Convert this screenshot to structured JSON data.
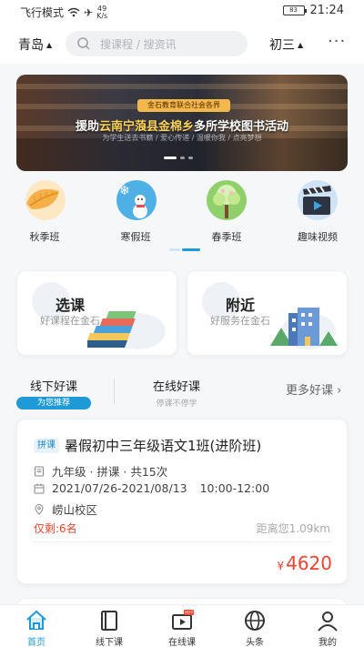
{
  "status_bar": {
    "left_text": "飞行模式",
    "speed": "49",
    "speed_unit": "K/s",
    "battery": "83",
    "time": "21:24"
  },
  "header": {
    "city": "青岛",
    "search_placeholder": "搜课程 / 搜资讯",
    "grade": "初三",
    "more_glyph": "···"
  },
  "banner": {
    "org_label": "金石教育联合社会各界",
    "headline_prefix": "援助",
    "headline_highlight": "云南宁蒗县金棉乡",
    "headline_suffix": "多所学校图书活动",
    "subline": "为学生送去书籍 / 爱心传递 / 温暖你我 / 点亮梦想",
    "page_count": 3,
    "active_page": 1
  },
  "categories": [
    {
      "label": "秋季班",
      "icon": "autumn-leaf-icon"
    },
    {
      "label": "寒假班",
      "icon": "snowman-icon"
    },
    {
      "label": "春季班",
      "icon": "spring-tree-icon"
    },
    {
      "label": "趣味视频",
      "icon": "clapperboard-icon"
    }
  ],
  "promos": [
    {
      "title": "选课",
      "subtitle": "好课程在金石",
      "icon": "books-icon"
    },
    {
      "title": "附近",
      "subtitle": "好服务在金石",
      "icon": "building-icon"
    }
  ],
  "tabs": {
    "offline": {
      "title": "线下好课",
      "tag": "为您推荐"
    },
    "online": {
      "title": "在线好课",
      "tag": "停课不停学"
    },
    "more_label": "更多好课",
    "more_arrow": "›"
  },
  "course": {
    "badge": "拼课",
    "title": "暑假初中三年级语文1班(进阶班)",
    "meta": "九年级 · 拼课 · 共15次",
    "dates": "2021/07/26-2021/08/13",
    "time": "10:00-12:00",
    "campus": "崂山校区",
    "remaining": "仅剩:6名",
    "distance": "距离您1.09km",
    "currency": "¥",
    "price": "4620"
  },
  "bottom_nav": [
    {
      "label": "首页",
      "active": true
    },
    {
      "label": "线下课",
      "active": false
    },
    {
      "label": "在线课",
      "active": false,
      "badge": "HOT"
    },
    {
      "label": "头条",
      "active": false
    },
    {
      "label": "我的",
      "active": false
    }
  ],
  "colors": {
    "accent": "#1f9ad6",
    "price": "#e8442f",
    "banner_tag": "#f2b84b"
  }
}
